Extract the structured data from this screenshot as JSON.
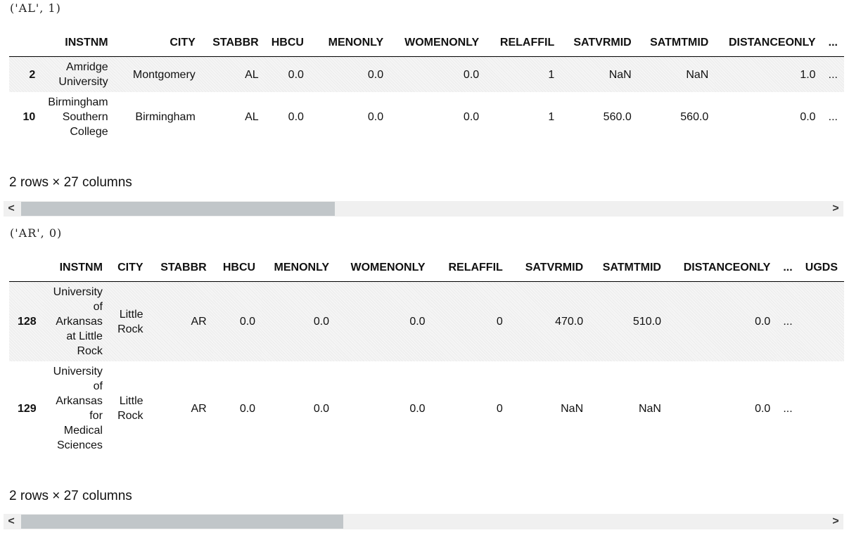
{
  "groups": [
    {
      "label": "('AL', 1)",
      "columns": [
        "INSTNM",
        "CITY",
        "STABBR",
        "HBCU",
        "MENONLY",
        "WOMENONLY",
        "RELAFFIL",
        "SATVRMID",
        "SATMTMID",
        "DISTANCEONLY",
        "..."
      ],
      "rows": [
        {
          "index": "2",
          "cells": [
            "Amridge University",
            "Montgomery",
            "AL",
            "0.0",
            "0.0",
            "0.0",
            "1",
            "NaN",
            "NaN",
            "1.0",
            "..."
          ]
        },
        {
          "index": "10",
          "cells": [
            "Birmingham Southern College",
            "Birmingham",
            "AL",
            "0.0",
            "0.0",
            "0.0",
            "1",
            "560.0",
            "560.0",
            "0.0",
            "..."
          ]
        }
      ],
      "summary": "2 rows × 27 columns",
      "scroll_fraction": 0.39
    },
    {
      "label": "('AR', 0)",
      "columns": [
        "INSTNM",
        "CITY",
        "STABBR",
        "HBCU",
        "MENONLY",
        "WOMENONLY",
        "RELAFFIL",
        "SATVRMID",
        "SATMTMID",
        "DISTANCEONLY",
        "...",
        "UGDS"
      ],
      "rows": [
        {
          "index": "128",
          "cells": [
            "University of Arkansas at Little Rock",
            "Little Rock",
            "AR",
            "0.0",
            "0.0",
            "0.0",
            "0",
            "470.0",
            "510.0",
            "0.0",
            "...",
            ""
          ]
        },
        {
          "index": "129",
          "cells": [
            "University of Arkansas for Medical Sciences",
            "Little Rock",
            "AR",
            "0.0",
            "0.0",
            "0.0",
            "0",
            "NaN",
            "NaN",
            "0.0",
            "...",
            ""
          ]
        }
      ],
      "summary": "2 rows × 27 columns",
      "scroll_fraction": 0.4
    }
  ],
  "scrollbar": {
    "left_arrow": "<",
    "right_arrow": ">"
  }
}
